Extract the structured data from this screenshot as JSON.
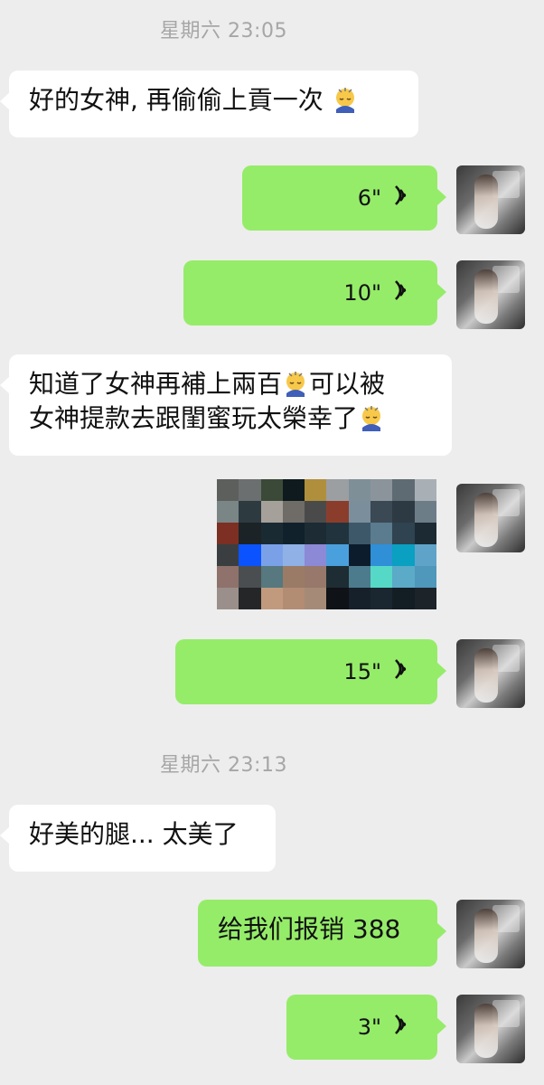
{
  "timestamps": [
    "星期六 23:05",
    "星期六 23:13"
  ],
  "messages": {
    "m1": "好的女神, 再偷偷上貢一次",
    "m2": "6\"",
    "m3": "10\"",
    "m4_line1": "知道了女神再補上兩百",
    "m4_line1b": "可以被",
    "m4_line2": "女神提款去跟閨蜜玩太榮幸了",
    "m5": "15\"",
    "m6": "好美的腿... 太美了",
    "m7": "给我们报销 388",
    "m8": "3\""
  },
  "icons": {
    "emoji": "bowing-person-emoji",
    "voice": "voice-wave-icon"
  },
  "colors": {
    "background": "#ededed",
    "incoming_bubble": "#ffffff",
    "outgoing_bubble": "#95ec69",
    "timestamp": "#a6a6a6"
  },
  "mosaic_colors": [
    "#5c5f5b",
    "#6c6f70",
    "#3b4a38",
    "#0f1a1e",
    "#b08f3c",
    "#9b9fa2",
    "#7e8f98",
    "#8c949b",
    "#5f6b73",
    "#a8b0b5",
    "#7a8586",
    "#2d3b41",
    "#a6a09a",
    "#6f6b66",
    "#4b4a4a",
    "#8b3d2c",
    "#7b8e9c",
    "#3a4953",
    "#2d3a44",
    "#6d7d88",
    "#7c2f22",
    "#1b2326",
    "#1a2a33",
    "#10212b",
    "#1c2b34",
    "#21343e",
    "#3c5869",
    "#5b7b8e",
    "#2f4350",
    "#1c2a33",
    "#3a3e40",
    "#0b53ff",
    "#7aa1e8",
    "#8fb1e6",
    "#8c89d6",
    "#4aa0dc",
    "#0d1c2c",
    "#2f8fd7",
    "#0aa0c2",
    "#5fa4c8",
    "#8e726b",
    "#4a4e50",
    "#56787e",
    "#9a7b66",
    "#98786a",
    "#1e2d33",
    "#4d7b8e",
    "#56d8c7",
    "#5baac7",
    "#4f97bb",
    "#9a8f8a",
    "#242628",
    "#c19a7e",
    "#b28c73",
    "#a58a78",
    "#0f1216",
    "#16202a",
    "#1a2730",
    "#131d24",
    "#1c2429"
  ]
}
